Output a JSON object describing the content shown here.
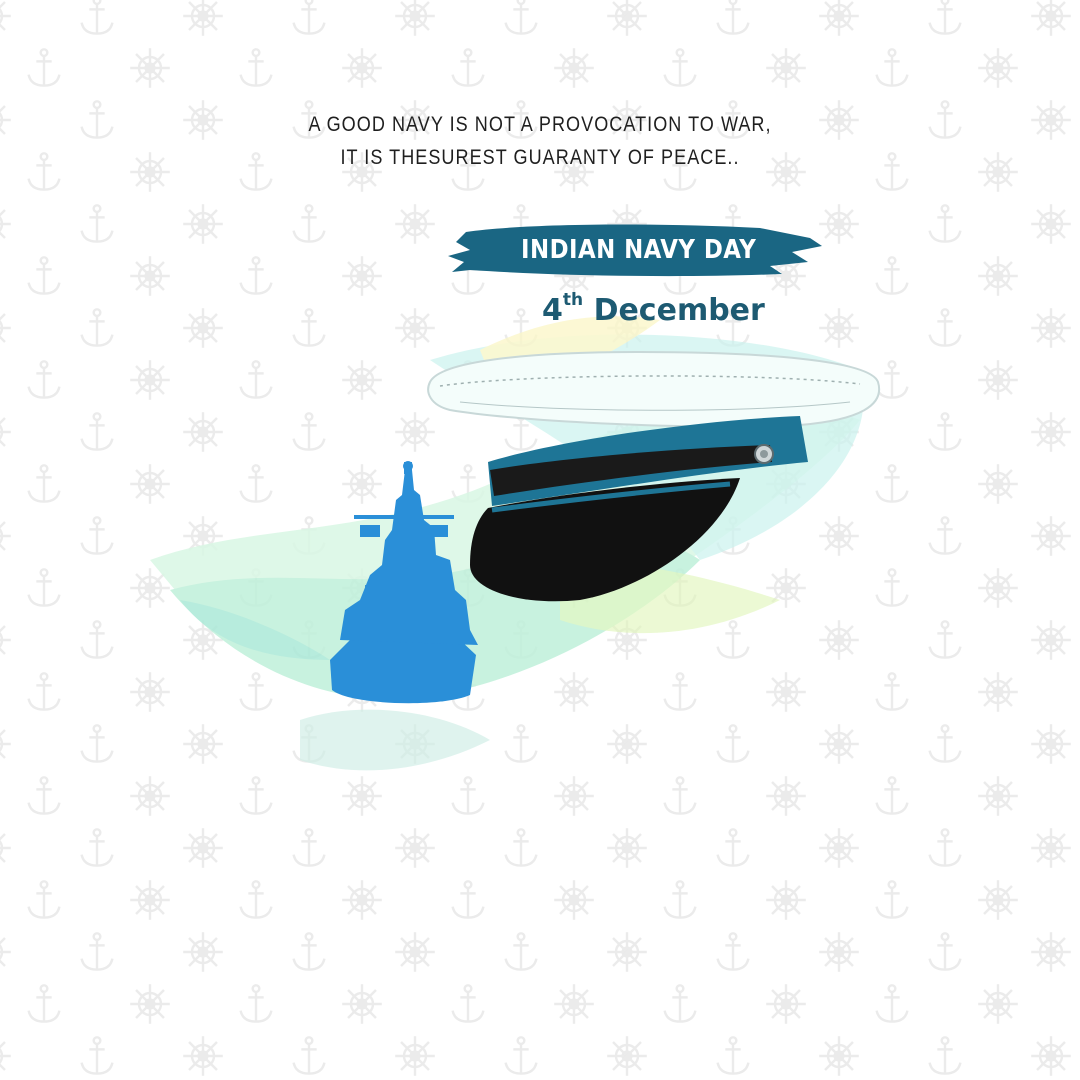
{
  "quote": {
    "line1": "A GOOD NAVY IS NOT A PROVOCATION TO WAR,",
    "line2": "IT IS THESUREST GUARANTY OF PEACE.."
  },
  "banner": {
    "title": "INDIAN NAVY DAY"
  },
  "date": {
    "day": "4",
    "suffix": "th",
    "month": "December"
  },
  "colors": {
    "banner": "#1a6683",
    "date_text": "#1d5a72",
    "ship": "#2a8fd8",
    "cap_band": "#1e7596",
    "cap_visor": "#111111",
    "pattern": "#eeeeee"
  },
  "icons": {
    "background_pattern": [
      "ship-wheel-icon",
      "anchor-icon"
    ],
    "illustration": [
      "warship-silhouette",
      "naval-officer-cap"
    ]
  }
}
